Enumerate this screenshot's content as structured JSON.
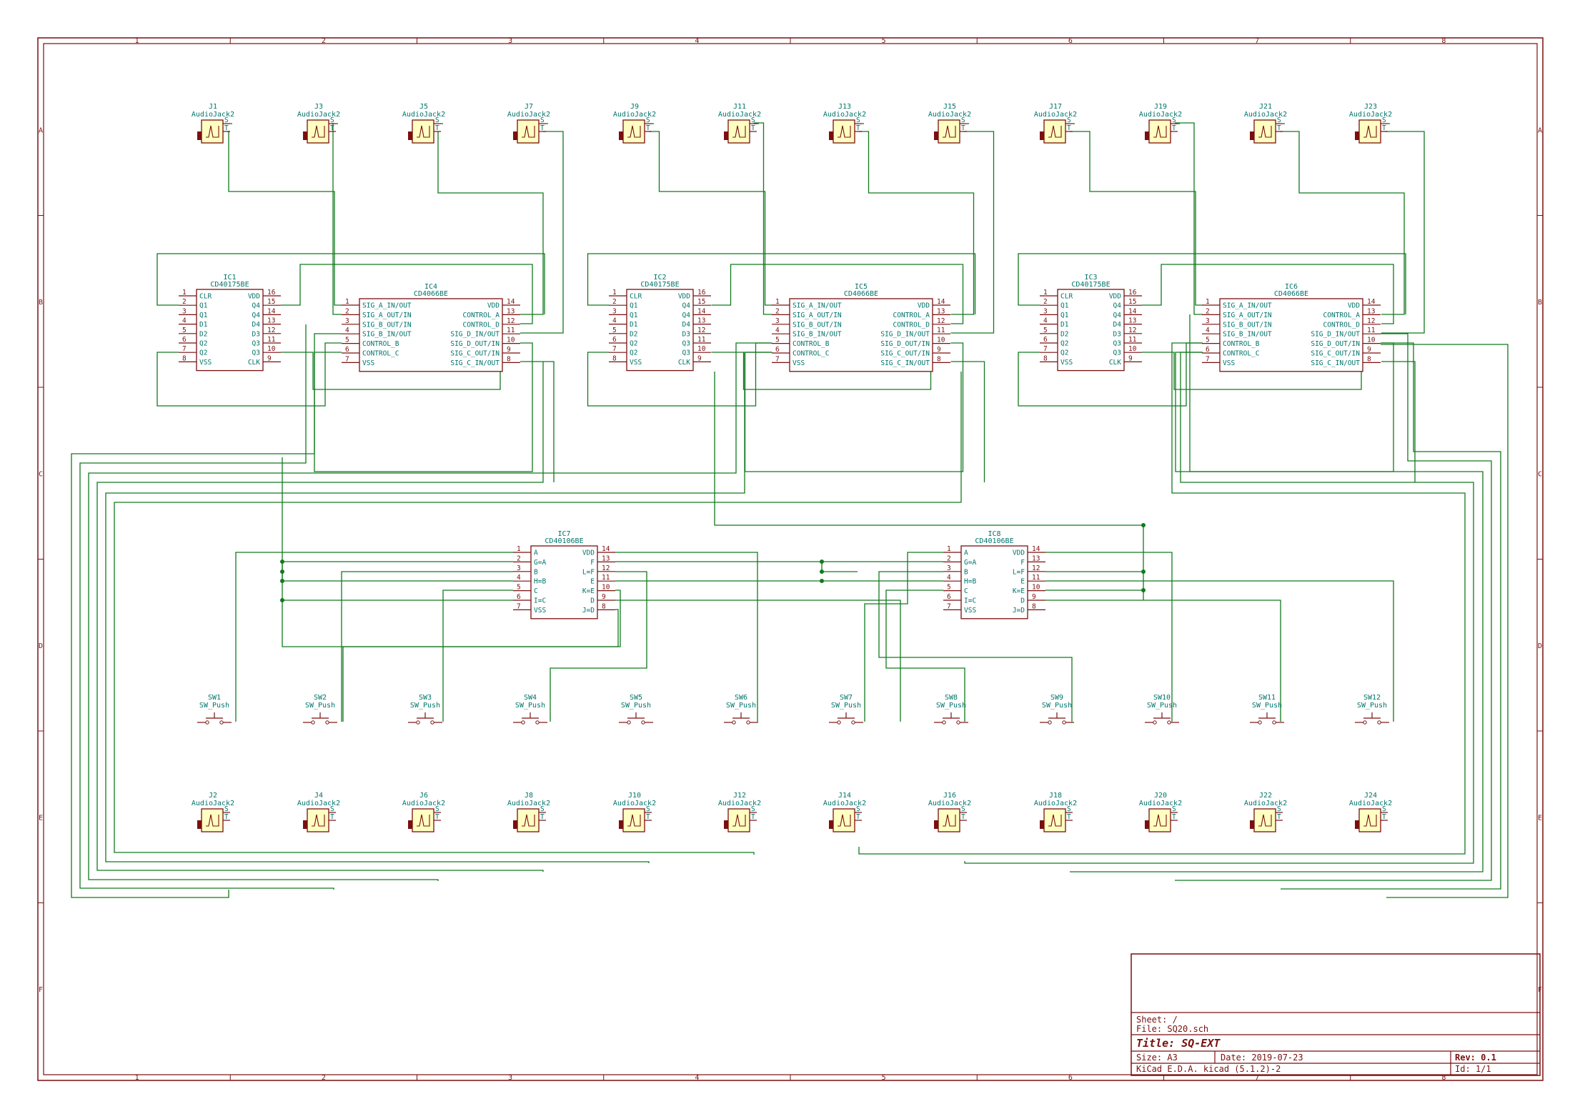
{
  "border": {
    "columns": [
      "1",
      "2",
      "3",
      "4",
      "5",
      "6",
      "7",
      "8"
    ],
    "rows": [
      "A",
      "B",
      "C",
      "D",
      "E",
      "F"
    ]
  },
  "title_block": {
    "sheet": "Sheet: /",
    "file": "File: SQ20.sch",
    "title": "Title: SQ-EXT",
    "size": "Size: A3",
    "date": "Date: 2019-07-23",
    "rev": "Rev: 0.1",
    "tool": "KiCad E.D.A.  kicad (5.1.2)-2",
    "id": "Id: 1/1"
  },
  "jacks_top": [
    {
      "ref": "J1",
      "value": "AudioJack2"
    },
    {
      "ref": "J3",
      "value": "AudioJack2"
    },
    {
      "ref": "J5",
      "value": "AudioJack2"
    },
    {
      "ref": "J7",
      "value": "AudioJack2"
    },
    {
      "ref": "J9",
      "value": "AudioJack2"
    },
    {
      "ref": "J11",
      "value": "AudioJack2"
    },
    {
      "ref": "J13",
      "value": "AudioJack2"
    },
    {
      "ref": "J15",
      "value": "AudioJack2"
    },
    {
      "ref": "J17",
      "value": "AudioJack2"
    },
    {
      "ref": "J19",
      "value": "AudioJack2"
    },
    {
      "ref": "J21",
      "value": "AudioJack2"
    },
    {
      "ref": "J23",
      "value": "AudioJack2"
    }
  ],
  "jacks_bottom": [
    {
      "ref": "J2",
      "value": "AudioJack2"
    },
    {
      "ref": "J4",
      "value": "AudioJack2"
    },
    {
      "ref": "J6",
      "value": "AudioJack2"
    },
    {
      "ref": "J8",
      "value": "AudioJack2"
    },
    {
      "ref": "J10",
      "value": "AudioJack2"
    },
    {
      "ref": "J12",
      "value": "AudioJack2"
    },
    {
      "ref": "J14",
      "value": "AudioJack2"
    },
    {
      "ref": "J16",
      "value": "AudioJack2"
    },
    {
      "ref": "J18",
      "value": "AudioJack2"
    },
    {
      "ref": "J20",
      "value": "AudioJack2"
    },
    {
      "ref": "J22",
      "value": "AudioJack2"
    },
    {
      "ref": "J24",
      "value": "AudioJack2"
    }
  ],
  "jack_pins": {
    "s": "S",
    "t": "T"
  },
  "switches": [
    {
      "ref": "SW1",
      "value": "SW_Push"
    },
    {
      "ref": "SW2",
      "value": "SW_Push"
    },
    {
      "ref": "SW3",
      "value": "SW_Push"
    },
    {
      "ref": "SW4",
      "value": "SW_Push"
    },
    {
      "ref": "SW5",
      "value": "SW_Push"
    },
    {
      "ref": "SW6",
      "value": "SW_Push"
    },
    {
      "ref": "SW7",
      "value": "SW_Push"
    },
    {
      "ref": "SW8",
      "value": "SW_Push"
    },
    {
      "ref": "SW9",
      "value": "SW_Push"
    },
    {
      "ref": "SW10",
      "value": "SW_Push"
    },
    {
      "ref": "SW11",
      "value": "SW_Push"
    },
    {
      "ref": "SW12",
      "value": "SW_Push"
    }
  ],
  "ic_4017": [
    {
      "ref": "IC1",
      "value": "CD40175BE"
    },
    {
      "ref": "IC2",
      "value": "CD40175BE"
    },
    {
      "ref": "IC3",
      "value": "CD40175BE"
    }
  ],
  "ic_4066": [
    {
      "ref": "IC4",
      "value": "CD4066BE"
    },
    {
      "ref": "IC5",
      "value": "CD4066BE"
    },
    {
      "ref": "IC6",
      "value": "CD4066BE"
    }
  ],
  "ic_40106": [
    {
      "ref": "IC7",
      "value": "CD40106BE"
    },
    {
      "ref": "IC8",
      "value": "CD40106BE"
    }
  ],
  "pins_4017": {
    "left": [
      [
        "1",
        "CLR"
      ],
      [
        "2",
        "Q1"
      ],
      [
        "3",
        "Q1"
      ],
      [
        "4",
        "D1"
      ],
      [
        "5",
        "D2"
      ],
      [
        "6",
        "Q2"
      ],
      [
        "7",
        "Q2"
      ],
      [
        "8",
        "VSS"
      ]
    ],
    "right": [
      [
        "16",
        "VDD"
      ],
      [
        "15",
        "Q4"
      ],
      [
        "14",
        "Q4"
      ],
      [
        "13",
        "D4"
      ],
      [
        "12",
        "D3"
      ],
      [
        "11",
        "Q3"
      ],
      [
        "10",
        "Q3"
      ],
      [
        "9",
        "CLK"
      ]
    ]
  },
  "pins_4066": {
    "left": [
      [
        "1",
        "SIG_A_IN/OUT"
      ],
      [
        "2",
        "SIG_A_OUT/IN"
      ],
      [
        "3",
        "SIG_B_OUT/IN"
      ],
      [
        "4",
        "SIG_B_IN/OUT"
      ],
      [
        "5",
        "CONTROL_B"
      ],
      [
        "6",
        "CONTROL_C"
      ],
      [
        "7",
        "VSS"
      ]
    ],
    "right": [
      [
        "14",
        "VDD"
      ],
      [
        "13",
        "CONTROL_A"
      ],
      [
        "12",
        "CONTROL_D"
      ],
      [
        "11",
        "SIG_D_IN/OUT"
      ],
      [
        "10",
        "SIG_D_OUT/IN"
      ],
      [
        "9",
        "SIG_C_OUT/IN"
      ],
      [
        "8",
        "SIG_C_IN/OUT"
      ]
    ]
  },
  "pins_40106": {
    "left": [
      [
        "1",
        "A"
      ],
      [
        "2",
        "G=A"
      ],
      [
        "3",
        "B"
      ],
      [
        "4",
        "H=B"
      ],
      [
        "5",
        "C"
      ],
      [
        "6",
        "I=C"
      ],
      [
        "7",
        "VSS"
      ]
    ],
    "right": [
      [
        "14",
        "VDD"
      ],
      [
        "13",
        "F"
      ],
      [
        "12",
        "L=F"
      ],
      [
        "11",
        "E"
      ],
      [
        "10",
        "K=E"
      ],
      [
        "9",
        "D"
      ],
      [
        "8",
        "J=D"
      ]
    ]
  },
  "colors": {
    "wire": "#117a1e",
    "body": "#7a0f0f",
    "fill": "#ffffc2",
    "text": "#00746b",
    "pin": "#7a0f0f"
  }
}
